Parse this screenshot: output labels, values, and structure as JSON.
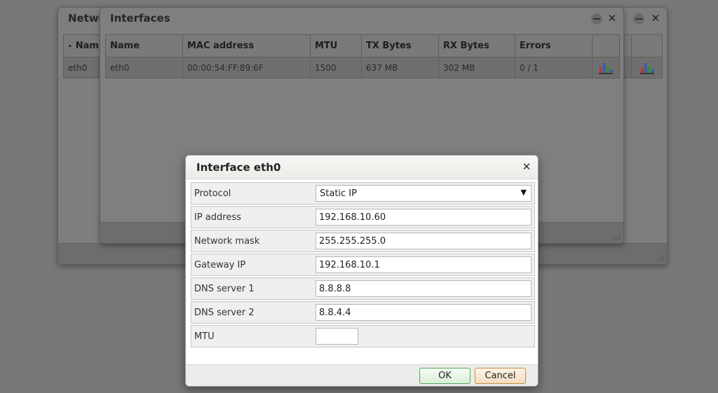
{
  "network_window": {
    "title": "Network",
    "columns": [
      "Nam"
    ],
    "rows": [
      {
        "name": "eth0"
      }
    ]
  },
  "interfaces_window": {
    "title": "Interfaces",
    "columns": [
      "Name",
      "MAC address",
      "MTU",
      "TX Bytes",
      "RX Bytes",
      "Errors"
    ],
    "rows": [
      {
        "name": "eth0",
        "mac": "00:00:54:FF:89:6F",
        "mtu": "1500",
        "tx": "637 MB",
        "rx": "302 MB",
        "errors": "0 / 1"
      }
    ]
  },
  "dialog": {
    "title": "Interface eth0",
    "protocol": {
      "label": "Protocol",
      "value": "Static IP"
    },
    "ip_address": {
      "label": "IP address",
      "value": "192.168.10.60"
    },
    "network_mask": {
      "label": "Network mask",
      "value": "255.255.255.0"
    },
    "gateway_ip": {
      "label": "Gateway IP",
      "value": "192.168.10.1"
    },
    "dns1": {
      "label": "DNS server 1",
      "value": "8.8.8.8"
    },
    "dns2": {
      "label": "DNS server 2",
      "value": "8.8.4.4"
    },
    "mtu": {
      "label": "MTU",
      "value": ""
    },
    "ok_label": "OK",
    "cancel_label": "Cancel"
  },
  "icons": {
    "minimize": "minimize-icon",
    "close": "close-icon",
    "stats": "bar-chart-icon",
    "dropdown": "dropdown-arrow-icon"
  },
  "colors": {
    "ok_border": "#4fa85a",
    "cancel_border": "#c88d3d",
    "overlay": "#787878"
  }
}
